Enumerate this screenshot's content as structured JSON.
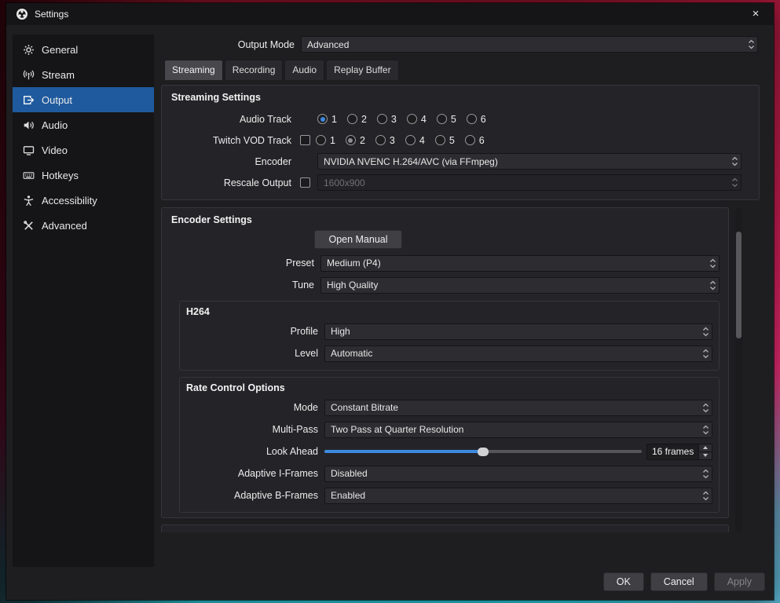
{
  "window": {
    "title": "Settings",
    "close_glyph": "×"
  },
  "sidebar": {
    "selected": "Output",
    "items": [
      {
        "label": "General",
        "icon": "gear-icon"
      },
      {
        "label": "Stream",
        "icon": "broadcast-icon"
      },
      {
        "label": "Output",
        "icon": "output-icon"
      },
      {
        "label": "Audio",
        "icon": "speaker-icon"
      },
      {
        "label": "Video",
        "icon": "monitor-icon"
      },
      {
        "label": "Hotkeys",
        "icon": "keyboard-icon"
      },
      {
        "label": "Accessibility",
        "icon": "accessibility-icon"
      },
      {
        "label": "Advanced",
        "icon": "tools-icon"
      }
    ]
  },
  "output_mode": {
    "label": "Output Mode",
    "value": "Advanced"
  },
  "tabs": {
    "active": "Streaming",
    "items": [
      {
        "label": "Streaming"
      },
      {
        "label": "Recording"
      },
      {
        "label": "Audio"
      },
      {
        "label": "Replay Buffer"
      }
    ]
  },
  "streaming": {
    "title": "Streaming Settings",
    "audio_track": {
      "label": "Audio Track",
      "options": [
        "1",
        "2",
        "3",
        "4",
        "5",
        "6"
      ],
      "selected": "1"
    },
    "vod_track": {
      "label": "Twitch VOD Track",
      "checkbox_checked": false,
      "options": [
        "1",
        "2",
        "3",
        "4",
        "5",
        "6"
      ],
      "selected": "2"
    },
    "encoder": {
      "label": "Encoder",
      "value": "NVIDIA NVENC H.264/AVC (via FFmpeg)"
    },
    "rescale": {
      "label": "Rescale Output",
      "checkbox_checked": false,
      "value": "1600x900",
      "disabled": true
    }
  },
  "encoder_settings": {
    "title": "Encoder Settings",
    "open_manual_label": "Open Manual",
    "preset": {
      "label": "Preset",
      "value": "Medium (P4)"
    },
    "tune": {
      "label": "Tune",
      "value": "High Quality"
    },
    "h264": {
      "title": "H264",
      "profile": {
        "label": "Profile",
        "value": "High"
      },
      "level": {
        "label": "Level",
        "value": "Automatic"
      }
    },
    "rate_control": {
      "title": "Rate Control Options",
      "mode": {
        "label": "Mode",
        "value": "Constant Bitrate"
      },
      "multi_pass": {
        "label": "Multi-Pass",
        "value": "Two Pass at Quarter Resolution"
      },
      "look_ahead": {
        "label": "Look Ahead",
        "value": "16 frames",
        "slider_percent": 50
      },
      "adaptive_i_frames": {
        "label": "Adaptive I-Frames",
        "value": "Disabled"
      },
      "adaptive_b_frames": {
        "label": "Adaptive B-Frames",
        "value": "Enabled"
      }
    }
  },
  "footer": {
    "ok": "OK",
    "cancel": "Cancel",
    "apply": "Apply",
    "apply_enabled": false
  }
}
